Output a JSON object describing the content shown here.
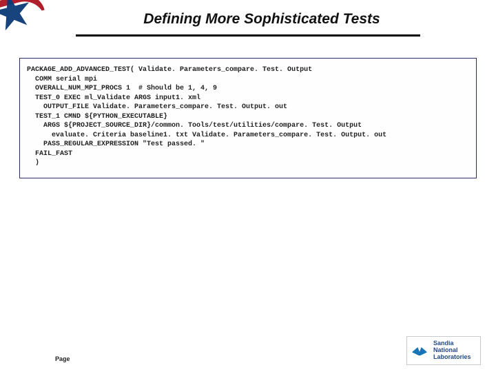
{
  "header": {
    "title": "Defining More Sophisticated Tests"
  },
  "code": {
    "lines": [
      "PACKAGE_ADD_ADVANCED_TEST( Validate. Parameters_compare. Test. Output",
      "  COMM serial mpi",
      "  OVERALL_NUM_MPI_PROCS 1  # Should be 1, 4, 9",
      "  TEST_0 EXEC ml_Validate ARGS input1. xml",
      "    OUTPUT_FILE Validate. Parameters_compare. Test. Output. out",
      "  TEST_1 CMND ${PYTHON_EXECUTABLE}",
      "    ARGS ${PROJECT_SOURCE_DIR}/common. Tools/test/utilities/compare. Test. Output",
      "      evaluate. Criteria baseline1. txt Validate. Parameters_compare. Test. Output. out",
      "    PASS_REGULAR_EXPRESSION \"Test passed. \"",
      "  FAIL_FAST",
      "  )"
    ]
  },
  "footer": {
    "page_label": "Page",
    "logo": {
      "line1": "Sandia",
      "line2": "National",
      "line3": "Laboratories"
    }
  }
}
